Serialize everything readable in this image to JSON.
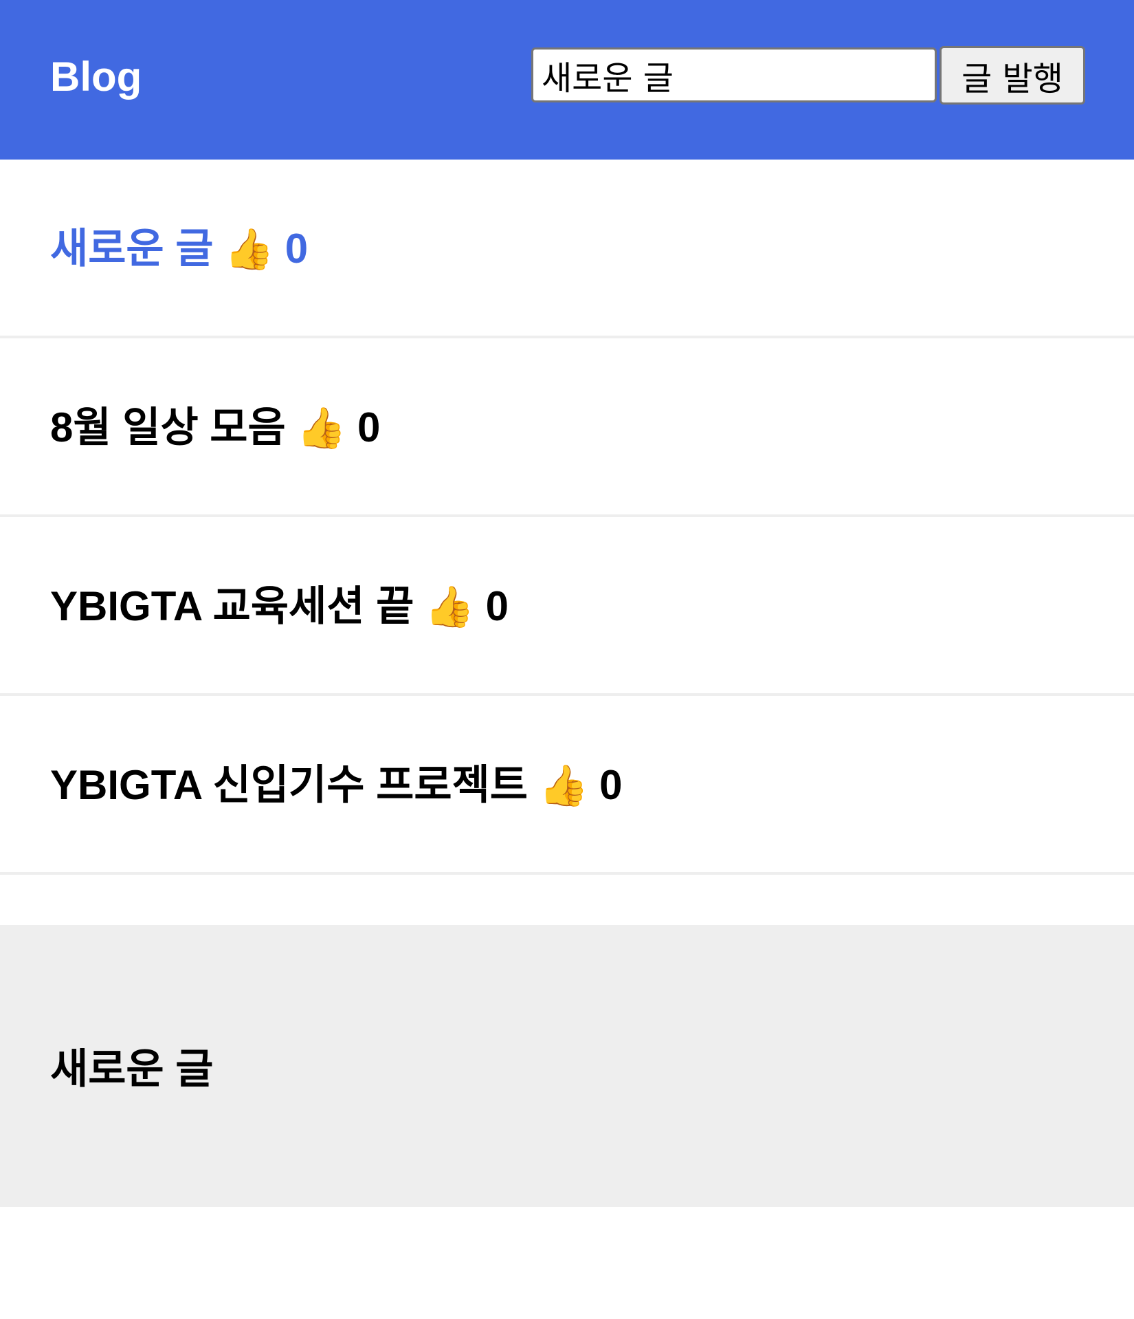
{
  "header": {
    "brand": "Blog",
    "input_value": "새로운 글",
    "publish_label": "글 발행"
  },
  "posts": [
    {
      "title": "새로운 글",
      "like_icon": "👍",
      "likes": "0",
      "selected": true
    },
    {
      "title": "8월 일상 모음",
      "like_icon": "👍",
      "likes": "0",
      "selected": false
    },
    {
      "title": "YBIGTA 교육세션 끝",
      "like_icon": "👍",
      "likes": "0",
      "selected": false
    },
    {
      "title": "YBIGTA 신입기수 프로젝트",
      "like_icon": "👍",
      "likes": "0",
      "selected": false
    }
  ],
  "detail": {
    "title": "새로운 글"
  },
  "colors": {
    "header_bg": "#4169e1",
    "selected_title": "#4169e1",
    "detail_bg": "#eeeeee",
    "divider": "#eeeeee"
  }
}
